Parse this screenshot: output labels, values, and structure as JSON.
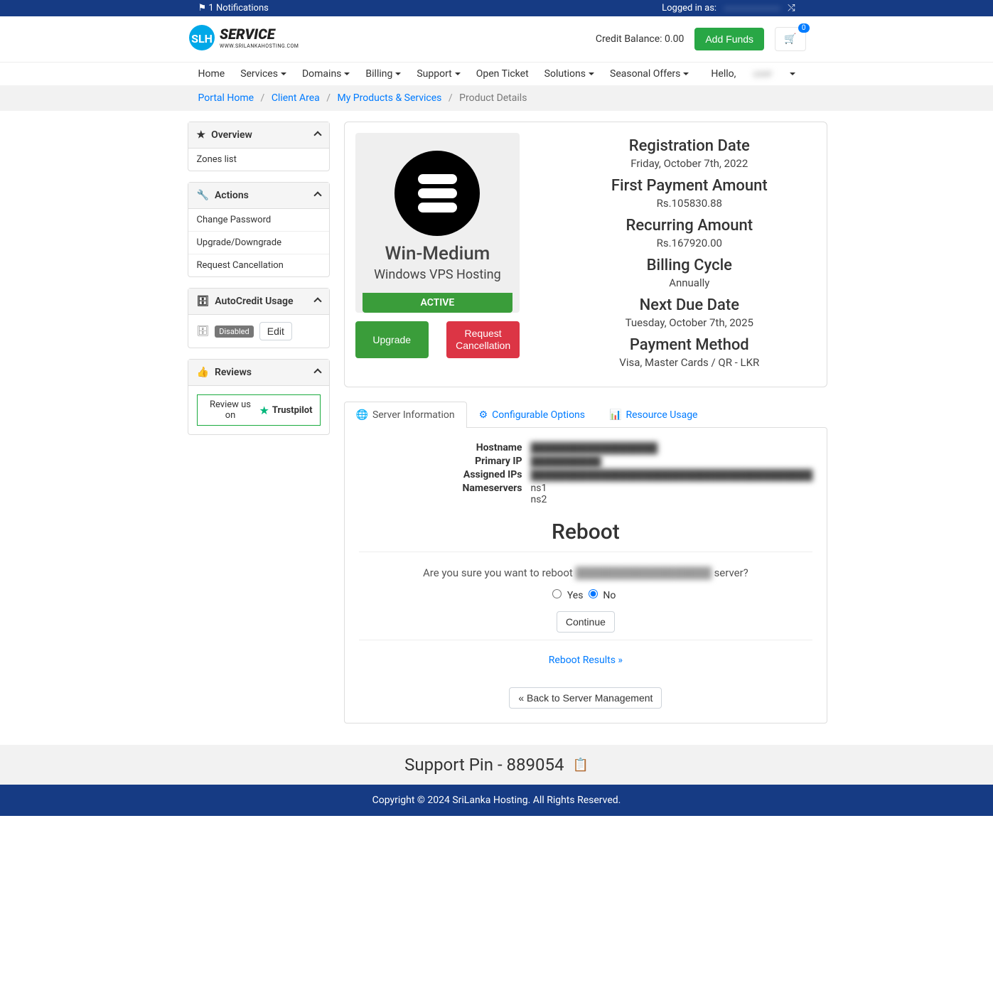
{
  "topbar": {
    "notifications_count": "1",
    "notifications_label": "Notifications",
    "logged_in_as": "Logged in as:",
    "user_masked": "████████"
  },
  "header": {
    "credit_label": "Credit Balance: 0.00",
    "add_funds": "Add Funds",
    "cart_count": "0"
  },
  "nav": {
    "items": [
      "Home",
      "Services",
      "Domains",
      "Billing",
      "Support",
      "Open Ticket",
      "Solutions",
      "Seasonal Offers"
    ],
    "hello": "Hello,",
    "user_masked": "████"
  },
  "breadcrumb": {
    "home": "Portal Home",
    "client": "Client Area",
    "products": "My Products & Services",
    "current": "Product Details"
  },
  "sidebar": {
    "overview": {
      "title": "Overview",
      "items": [
        "Zones list"
      ]
    },
    "actions": {
      "title": "Actions",
      "items": [
        "Change Password",
        "Upgrade/Downgrade",
        "Request Cancellation"
      ]
    },
    "autocredit": {
      "title": "AutoCredit Usage",
      "status": "Disabled",
      "edit": "Edit"
    },
    "reviews": {
      "title": "Reviews",
      "trustpilot_pre": "Review us on",
      "trustpilot": "Trustpilot"
    }
  },
  "product": {
    "name": "Win-Medium",
    "type": "Windows VPS Hosting",
    "status": "ACTIVE",
    "upgrade": "Upgrade",
    "cancel": "Request Cancellation",
    "info": {
      "reg_h": "Registration Date",
      "reg_v": "Friday, October 7th, 2022",
      "first_h": "First Payment Amount",
      "first_v": "Rs.105830.88",
      "recur_h": "Recurring Amount",
      "recur_v": "Rs.167920.00",
      "cycle_h": "Billing Cycle",
      "cycle_v": "Annually",
      "due_h": "Next Due Date",
      "due_v": "Tuesday, October 7th, 2025",
      "pay_h": "Payment Method",
      "pay_v": "Visa, Master Cards / QR - LKR"
    }
  },
  "tabs": {
    "server": "Server Information",
    "config": "Configurable Options",
    "resource": "Resource Usage"
  },
  "server": {
    "hostname_k": "Hostname",
    "hostname_v": "██████████████████",
    "ip_k": "Primary IP",
    "ip_v": "██████████",
    "assigned_k": "Assigned IPs",
    "assigned_v": "████████████████████████████████████████",
    "ns_k": "Nameservers",
    "ns1": "ns1",
    "ns2": "ns2"
  },
  "reboot": {
    "heading": "Reboot",
    "q_pre": "Are you sure you want to reboot ",
    "q_host": "██████████████████",
    "q_post": " server?",
    "yes": "Yes",
    "no": "No",
    "continue": "Continue",
    "results": "Reboot Results »",
    "back": "« Back to Server Management"
  },
  "support": {
    "label": "Support Pin - 889054"
  },
  "footer": {
    "text": "Copyright © 2024 SriLanka Hosting. All Rights Reserved."
  }
}
